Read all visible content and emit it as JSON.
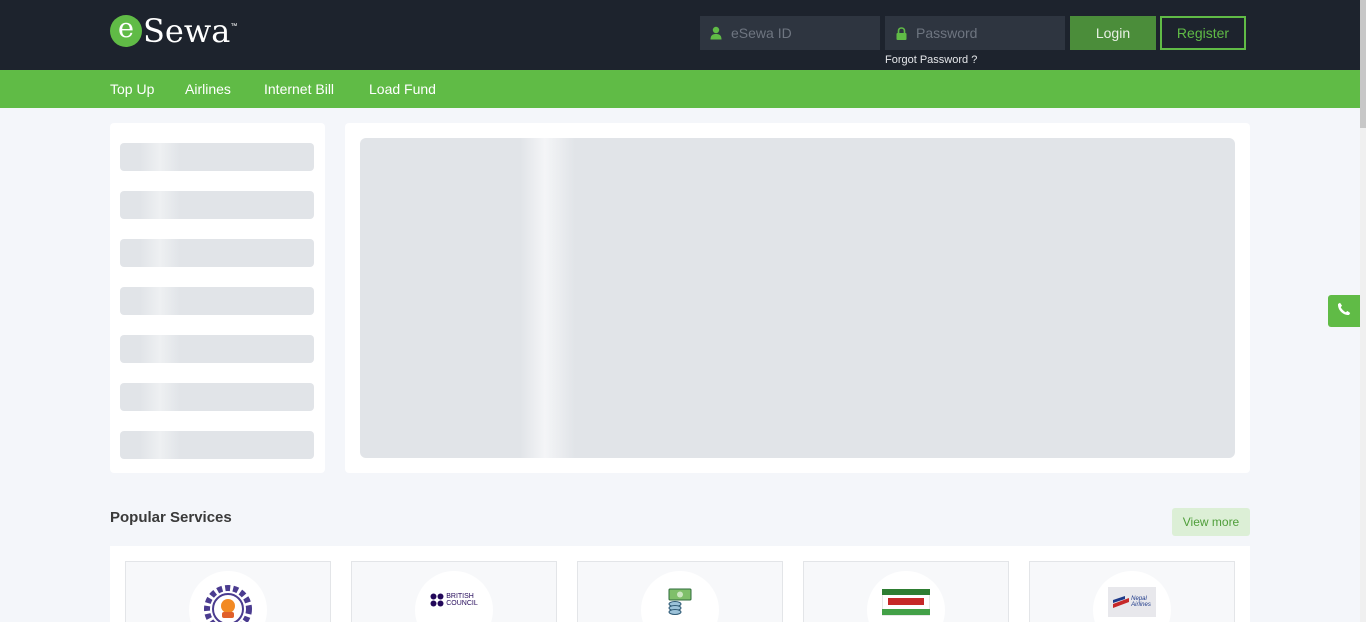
{
  "brand": {
    "logo_letter": "e",
    "logo_word": "Sewa",
    "trademark": "™",
    "accent_color": "#60bb46",
    "header_bg": "#1d232d"
  },
  "login": {
    "id_placeholder": "eSewa ID",
    "password_placeholder": "Password",
    "forgot_label": "Forgot Password ?",
    "login_label": "Login",
    "register_label": "Register",
    "user_icon": "user-icon",
    "lock_icon": "lock-icon"
  },
  "nav": {
    "items": [
      {
        "label": "Top Up"
      },
      {
        "label": "Airlines"
      },
      {
        "label": "Internet Bill"
      },
      {
        "label": "Load Fund"
      }
    ]
  },
  "popular": {
    "title": "Popular Services",
    "view_more_label": "View more",
    "services": [
      {
        "icon": "gear-emblem-logo"
      },
      {
        "icon": "british-council-logo",
        "logo_text_1": "BRITISH",
        "logo_text_2": "COUNCIL"
      },
      {
        "icon": "money-stack-logo"
      },
      {
        "icon": "lottery-ticket-logo"
      },
      {
        "icon": "nepal-airlines-logo",
        "logo_text_1": "Nepal",
        "logo_text_2": "Airlines"
      }
    ]
  },
  "support": {
    "icon": "phone-icon"
  }
}
